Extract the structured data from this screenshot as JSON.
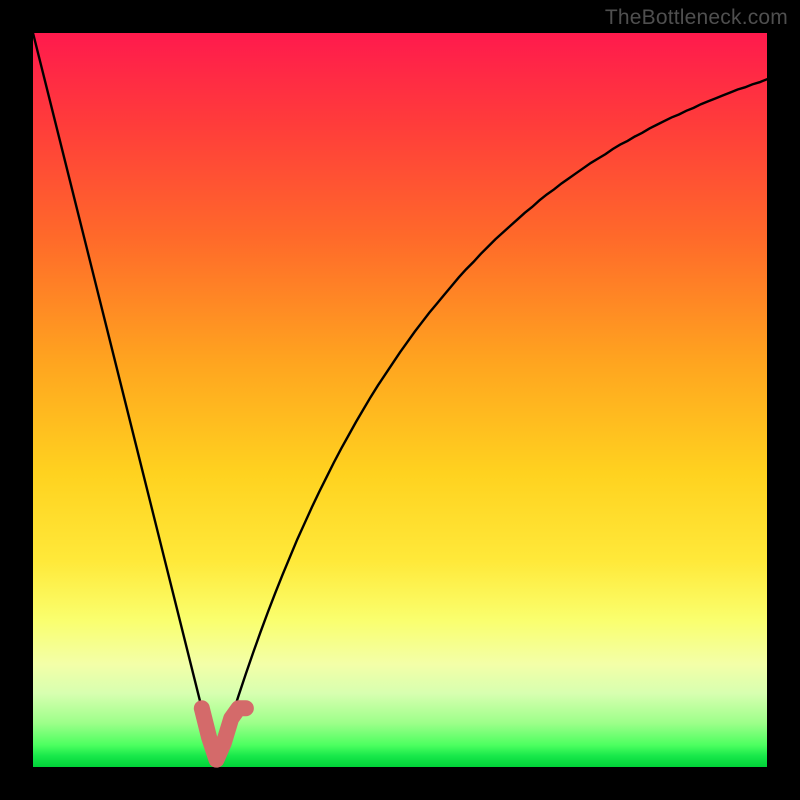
{
  "watermark": "TheBottleneck.com",
  "colors": {
    "frame": "#000000",
    "gradient_top": "#ff1a4d",
    "gradient_bottom": "#00d238",
    "curve": "#000000",
    "marker": "#d46a6a"
  },
  "chart_data": {
    "type": "line",
    "title": "",
    "xlabel": "",
    "ylabel": "",
    "xlim": [
      0,
      100
    ],
    "ylim": [
      0,
      100
    ],
    "x": [
      0,
      1,
      2,
      3,
      4,
      5,
      6,
      7,
      8,
      9,
      10,
      11,
      12,
      13,
      14,
      15,
      16,
      17,
      18,
      19,
      20,
      21,
      22,
      23,
      24,
      25,
      26,
      27,
      28,
      29,
      30,
      31,
      32,
      33,
      34,
      35,
      36,
      37,
      38,
      39,
      40,
      41,
      42,
      43,
      44,
      45,
      46,
      47,
      48,
      49,
      50,
      51,
      52,
      53,
      54,
      55,
      56,
      57,
      58,
      59,
      60,
      61,
      62,
      63,
      64,
      65,
      66,
      67,
      68,
      69,
      70,
      71,
      72,
      73,
      74,
      75,
      76,
      77,
      78,
      79,
      80,
      81,
      82,
      83,
      84,
      85,
      86,
      87,
      88,
      89,
      90,
      91,
      92,
      93,
      94,
      95,
      96,
      97,
      98,
      99,
      100
    ],
    "values": [
      100.0,
      96.0,
      92.0,
      88.0,
      84.0,
      80.0,
      76.0,
      72.0,
      68.0,
      64.0,
      60.0,
      56.0,
      52.0,
      48.0,
      44.0,
      40.0,
      36.0,
      32.0,
      28.0,
      24.0,
      20.0,
      16.0,
      12.0,
      8.0,
      4.0,
      0.0,
      3.3,
      6.6,
      9.7,
      12.7,
      15.6,
      18.4,
      21.1,
      23.7,
      26.2,
      28.6,
      31.0,
      33.2,
      35.4,
      37.5,
      39.5,
      41.5,
      43.4,
      45.2,
      47.0,
      48.7,
      50.4,
      52.0,
      53.5,
      55.0,
      56.5,
      57.9,
      59.3,
      60.6,
      61.9,
      63.1,
      64.3,
      65.5,
      66.7,
      67.8,
      68.8,
      69.9,
      70.9,
      71.9,
      72.8,
      73.7,
      74.6,
      75.5,
      76.3,
      77.2,
      78.0,
      78.7,
      79.5,
      80.2,
      80.9,
      81.6,
      82.3,
      82.9,
      83.5,
      84.2,
      84.8,
      85.3,
      85.9,
      86.4,
      87.0,
      87.5,
      88.0,
      88.5,
      88.9,
      89.4,
      89.8,
      90.3,
      90.7,
      91.1,
      91.5,
      91.9,
      92.3,
      92.6,
      93.0,
      93.3,
      93.7
    ],
    "optimal_zone": {
      "x_start": 23,
      "x_end": 29,
      "y_max": 8
    },
    "description": "V-shaped curve with a sharp minimum near x≈25 (y≈0); steep linear descent on the left and a concave-up rise on the right, on a vertical heat gradient from red (bad, top) to green (good, bottom)."
  }
}
